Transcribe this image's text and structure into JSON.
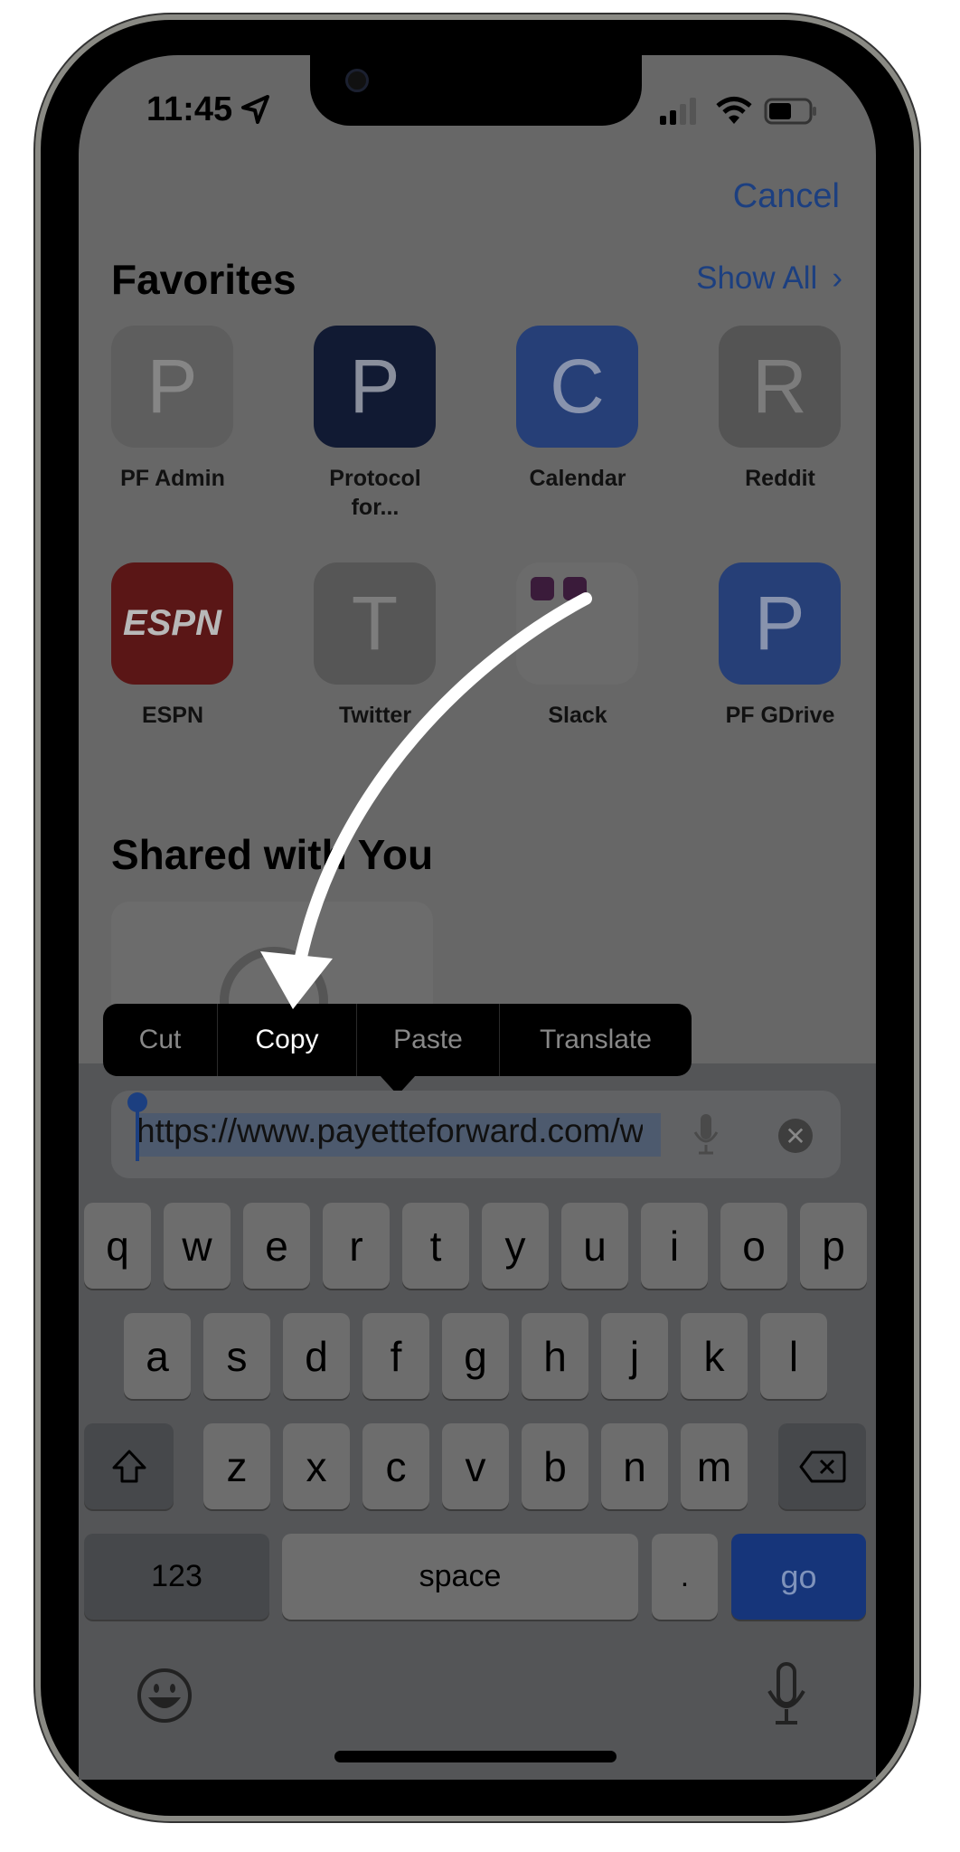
{
  "status": {
    "time": "11:45",
    "icons": [
      "location-arrow-icon",
      "signal-icon",
      "wifi-icon",
      "battery-icon"
    ]
  },
  "header": {
    "cancel": "Cancel"
  },
  "favorites": {
    "title": "Favorites",
    "show_all": "Show All",
    "items": [
      {
        "letter": "P",
        "label": "PF Admin",
        "label2": "",
        "bg": "#5e5e5e",
        "fg": "#868686"
      },
      {
        "letter": "P",
        "label": "Protocol",
        "label2": "for...",
        "bg": "#111a33",
        "fg": "#8a8f9c"
      },
      {
        "letter": "C",
        "label": "Calendar",
        "label2": "",
        "bg": "#263f77",
        "fg": "#8893ad"
      },
      {
        "letter": "R",
        "label": "Reddit",
        "label2": "",
        "bg": "#545454",
        "fg": "#7c7c7c"
      },
      {
        "letter": "ESPN",
        "label": "ESPN",
        "label2": "",
        "bg": "#5a1616",
        "fg": "#b8b8b8"
      },
      {
        "letter": "T",
        "label": "Twitter",
        "label2": "",
        "bg": "#565656",
        "fg": "#7d7d7d"
      },
      {
        "letter": "",
        "label": "Slack",
        "label2": "",
        "bg": "#6b6b6b",
        "fg": "#fff"
      },
      {
        "letter": "P",
        "label": "PF GDrive",
        "label2": "",
        "bg": "#263f77",
        "fg": "#8893ad"
      }
    ]
  },
  "shared": {
    "title": "Shared with You"
  },
  "edit_menu": {
    "items": [
      "Cut",
      "Copy",
      "Paste",
      "Translate"
    ],
    "highlighted": "Copy"
  },
  "url_field": {
    "value": "https://www.payetteforward.com/w"
  },
  "keyboard": {
    "row1": [
      "q",
      "w",
      "e",
      "r",
      "t",
      "y",
      "u",
      "i",
      "o",
      "p"
    ],
    "row2": [
      "a",
      "s",
      "d",
      "f",
      "g",
      "h",
      "j",
      "k",
      "l"
    ],
    "row3": [
      "z",
      "x",
      "c",
      "v",
      "b",
      "n",
      "m"
    ],
    "numbers": "123",
    "space": "space",
    "period": ".",
    "go": "go"
  },
  "colors": {
    "accent": "#1c3f80",
    "go": "#16357a",
    "selection": "#4d5a6e"
  }
}
